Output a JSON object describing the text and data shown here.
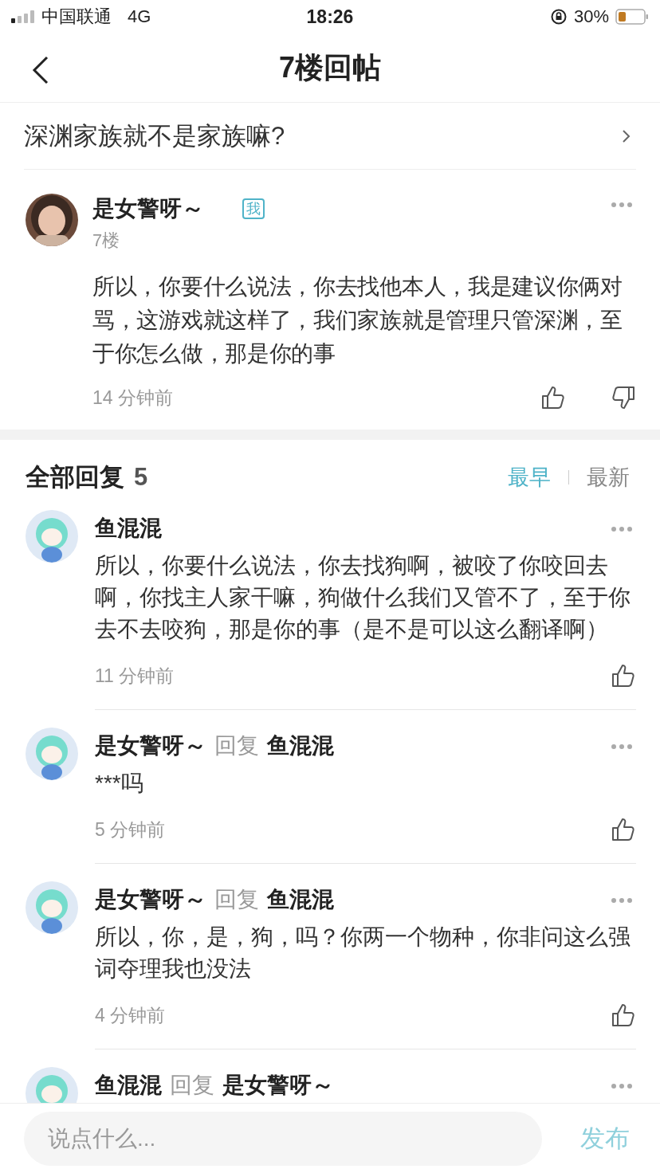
{
  "status_bar": {
    "carrier": "中国联通",
    "network": "4G",
    "time": "18:26",
    "battery_text": "30%"
  },
  "header": {
    "title": "7楼回帖"
  },
  "topic": {
    "title": "深渊家族就不是家族嘛?"
  },
  "post": {
    "author": "是女警呀～",
    "badge": "我",
    "floor": "7楼",
    "body": "所以，你要什么说法，你去找他本人，我是建议你俩对骂，这游戏就这样了，我们家族就是管理只管深渊，至于你怎么做，那是你的事",
    "time": "14 分钟前"
  },
  "replies": {
    "title": "全部回复",
    "count": "5",
    "sort": [
      {
        "label": "最早",
        "selected": true
      },
      {
        "label": "最新",
        "selected": false
      }
    ],
    "items": [
      {
        "author": "鱼混混",
        "body": "所以，你要什么说法，你去找狗啊，被咬了你咬回去啊，你找主人家干嘛，狗做什么我们又管不了，至于你去不去咬狗，那是你的事（是不是可以这么翻译啊）",
        "time": "11 分钟前"
      },
      {
        "author": "是女警呀～",
        "reply_label": "回复",
        "reply_to": "鱼混混",
        "body": "***吗",
        "time": "5 分钟前"
      },
      {
        "author": "是女警呀～",
        "reply_label": "回复",
        "reply_to": "鱼混混",
        "body": "所以，你，是，狗，吗？你两一个物种，你非问这么强词夺理我也没法",
        "time": "4 分钟前"
      },
      {
        "author": "鱼混混",
        "reply_label": "回复",
        "reply_to": "是女警呀～"
      }
    ]
  },
  "composer": {
    "placeholder": "说点什么...",
    "send": "发布"
  }
}
